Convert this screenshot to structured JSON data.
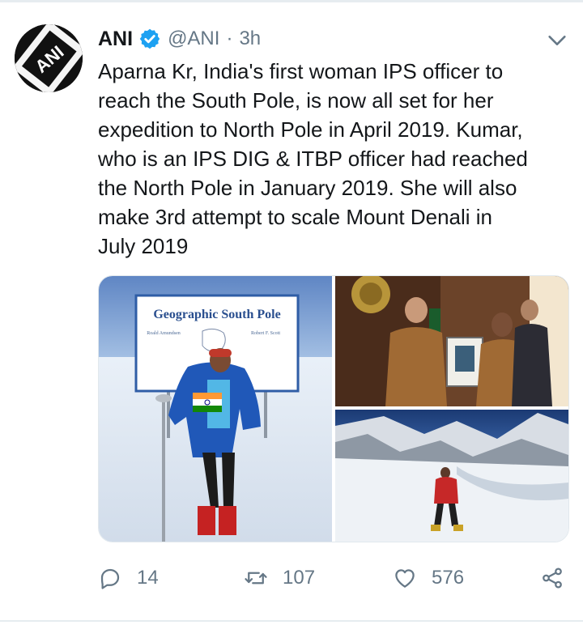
{
  "tweet": {
    "author_name": "ANI",
    "handle": "@ANI",
    "separator": "·",
    "time": "3h",
    "avatar_text": "ANI",
    "text_lines": [
      "Aparna Kr, India's first woman IPS officer to",
      "reach the South Pole, is now all set for her",
      "expedition to North Pole in April 2019. Kumar,",
      "who is an IPS DIG & ITBP officer had reached",
      "the North Pole in January 2019. She will also",
      "make 3rd attempt to scale Mount Denali in",
      "July 2019"
    ]
  },
  "media": {
    "sign_title": "Geographic South Pole",
    "sign_left_name": "Roald Amundsen",
    "sign_right_name": "Robert F. Scott"
  },
  "actions": {
    "reply_count": "14",
    "retweet_count": "107",
    "like_count": "576"
  },
  "icons": {
    "verified": "verified-badge-icon",
    "chevron": "chevron-down-icon",
    "reply": "reply-icon",
    "retweet": "retweet-icon",
    "like": "heart-icon",
    "share": "share-icon"
  },
  "colors": {
    "verified": "#1da1f2",
    "secondary_text": "#657786",
    "primary_text": "#14171a",
    "divider": "#e6ecf0"
  }
}
